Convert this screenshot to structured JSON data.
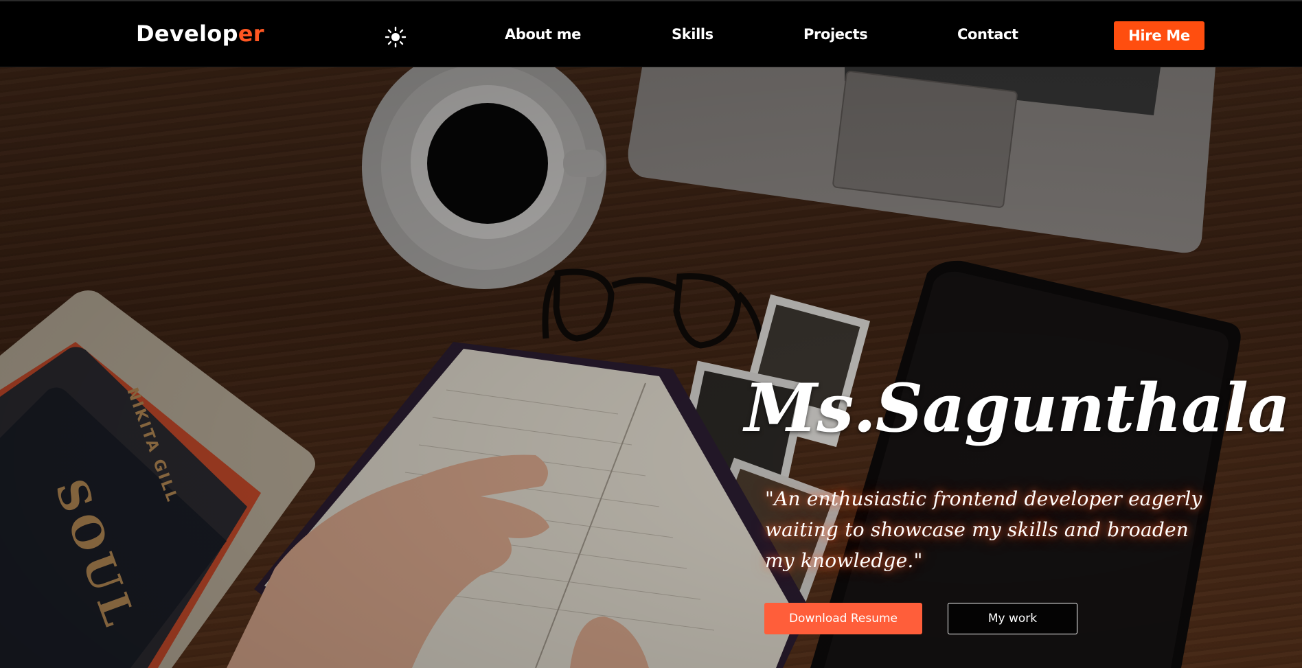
{
  "brand": {
    "prefix": "Develop",
    "accent": "er"
  },
  "nav": {
    "theme_icon": "sun-icon",
    "links": [
      "About me",
      "Skills",
      "Projects",
      "Contact"
    ],
    "cta": "Hire Me"
  },
  "hero": {
    "name": "Ms.Sagunthala",
    "quote": "\"An enthusiastic frontend developer eagerly waiting to showcase my skills and broaden my knowledge.\"",
    "primary_button": "Download Resume",
    "secondary_button": "My work"
  },
  "colors": {
    "accent": "#ff5722",
    "cta": "#ff4e0f",
    "resume_button": "#ff5e3a",
    "nav_bg": "#000000"
  }
}
